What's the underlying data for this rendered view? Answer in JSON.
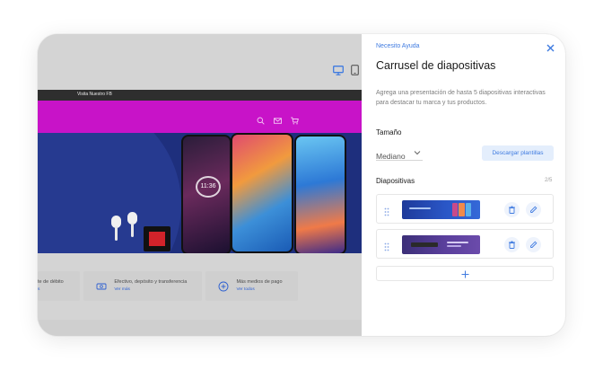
{
  "preview": {
    "topbar_text": "Visita Nuestro FB",
    "payments": [
      {
        "title": "te de débito",
        "link": "s"
      },
      {
        "title": "Efectivo, depósito y transferencia",
        "link": "Ver más"
      },
      {
        "title": "Más medios de pago",
        "link": "Ver todos"
      }
    ],
    "phone_time": "11:36"
  },
  "panel": {
    "help_link": "Necesito Ayuda",
    "title": "Carrusel de diapositivas",
    "description": "Agrega una presentación de hasta 5 diapositivas interactivas para destacar tu marca y tus productos.",
    "size_label": "Tamaño",
    "size_value": "Mediano",
    "download_label": "Descargar plantillas",
    "slides_label": "Diapositivas",
    "slides_count": "2/5"
  },
  "colors": {
    "accent": "#3f7be0",
    "navbar": "#c813c8",
    "hero": "#1e2f7d"
  },
  "icons": [
    "desktop-icon",
    "mobile-icon",
    "search-icon",
    "mail-icon",
    "cart-icon",
    "close-icon",
    "chevron-down-icon",
    "drag-handle-icon",
    "trash-icon",
    "pencil-icon",
    "plus-icon"
  ]
}
